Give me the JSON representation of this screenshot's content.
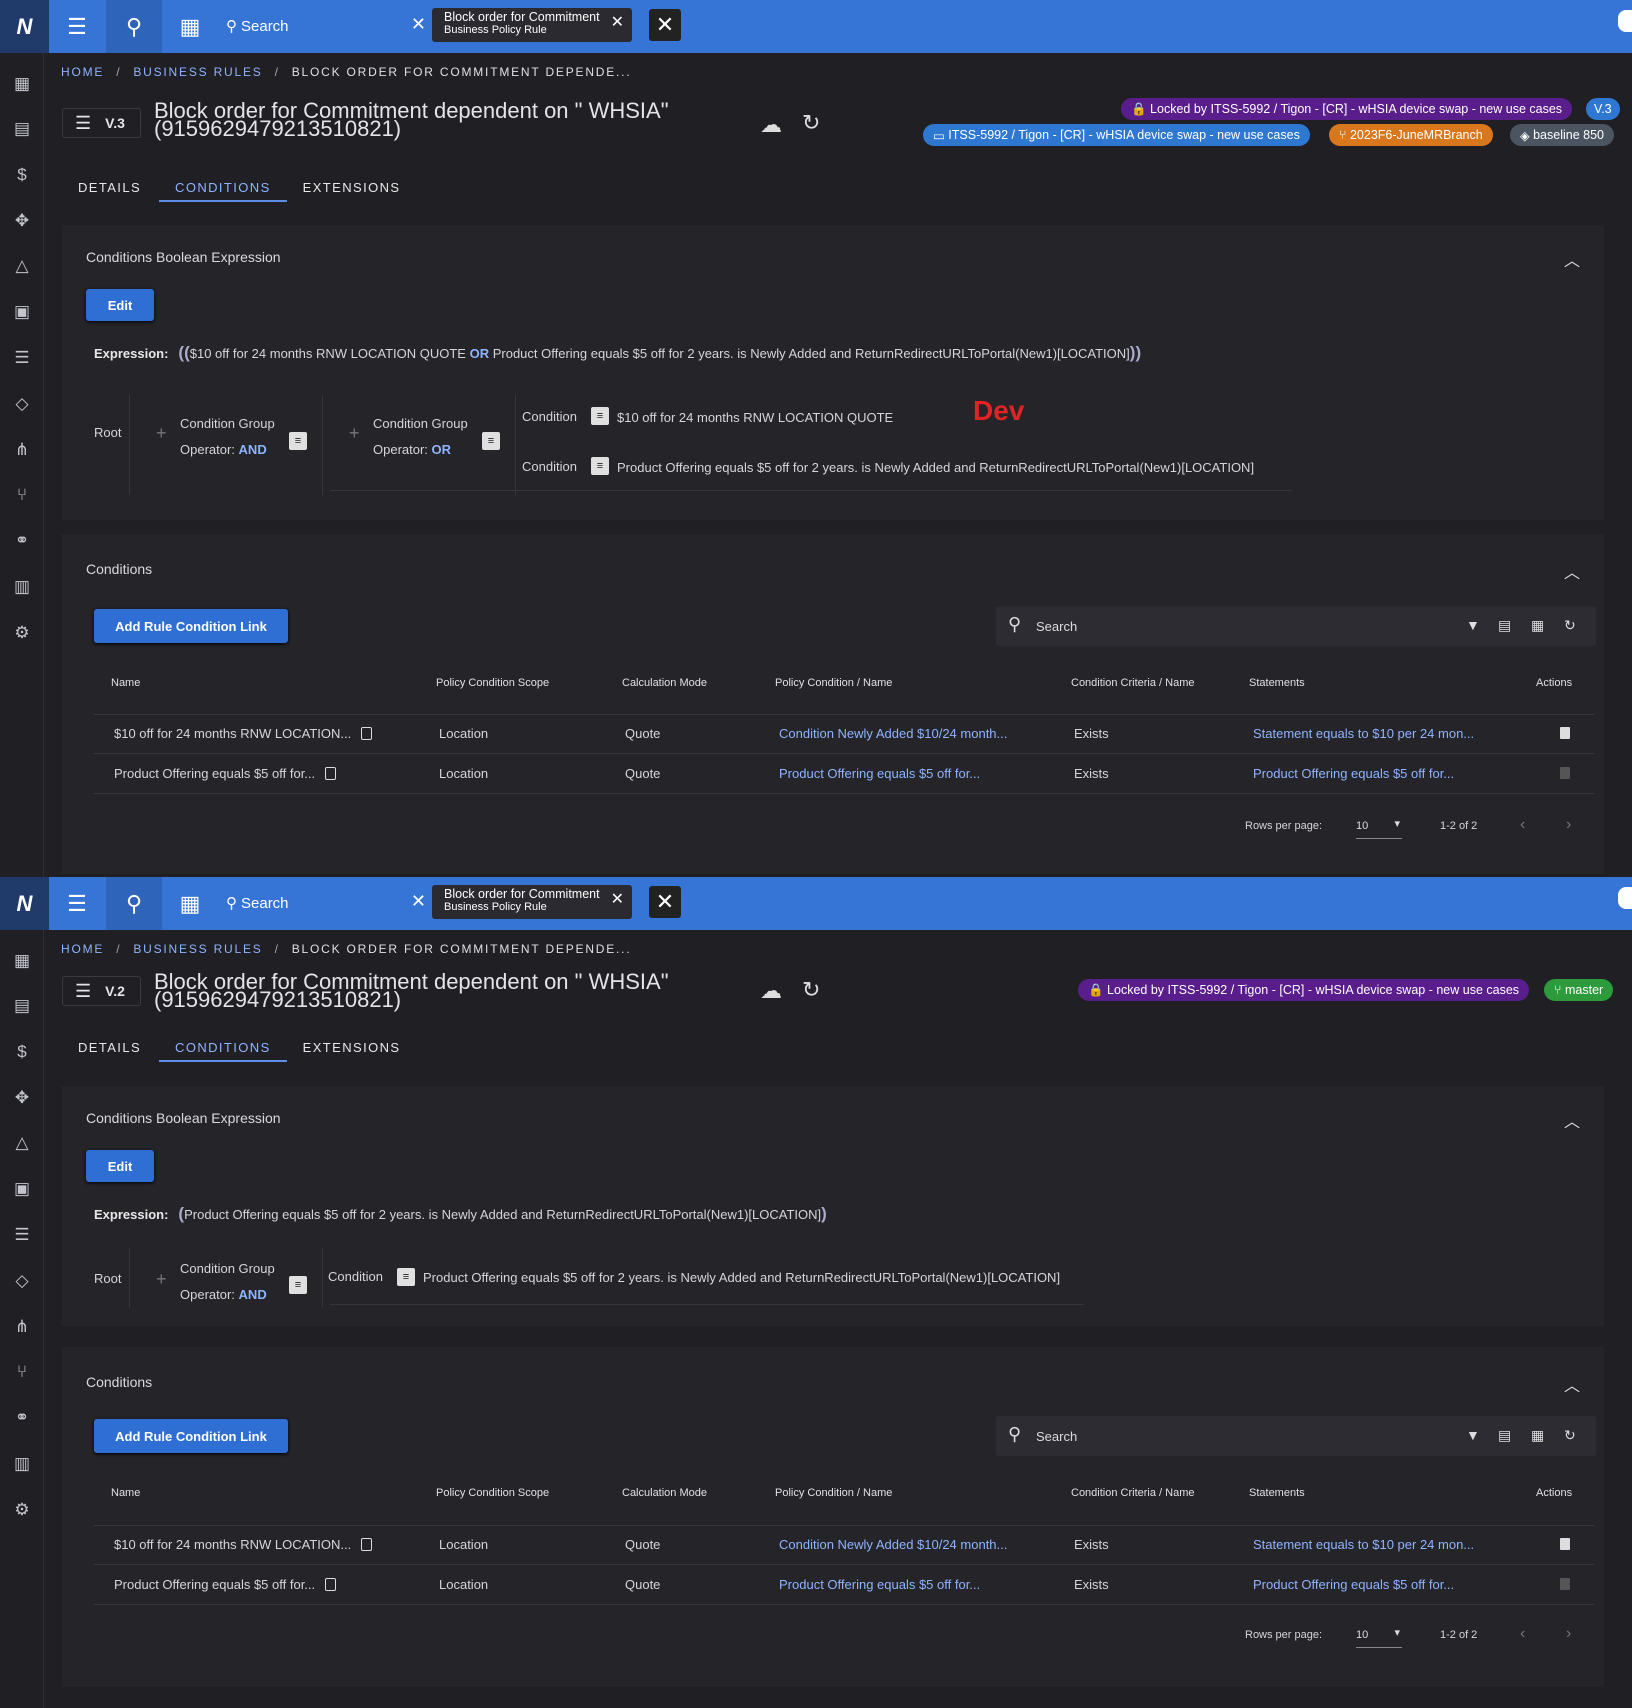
{
  "app": {
    "logo": "N",
    "search_label": "Search",
    "tab_title": "Block order for Commitment",
    "tab_subtitle": "Business Policy Rule"
  },
  "breadcrumb": {
    "home": "HOME",
    "section": "BUSINESS RULES",
    "current": "BLOCK ORDER FOR COMMITMENT DEPENDE..."
  },
  "record": {
    "title_line1": "Block order for Commitment dependent on \" WHSIA\"",
    "title_line2": "(9159629479213510821)"
  },
  "tabs": [
    "DETAILS",
    "CONDITIONS",
    "EXTENSIONS"
  ],
  "expression_panel": {
    "heading": "Conditions Boolean Expression",
    "edit_label": "Edit",
    "expression_label": "Expression:"
  },
  "conditions_panel": {
    "heading": "Conditions",
    "add_label": "Add Rule Condition Link",
    "search_placeholder": "Search",
    "columns": [
      "Name",
      "Policy Condition Scope",
      "Calculation Mode",
      "Policy Condition / Name",
      "Condition Criteria / Name",
      "Statements",
      "Actions"
    ],
    "rows": [
      {
        "name": "$10 off for 24 months RNW LOCATION...",
        "scope": "Location",
        "mode": "Quote",
        "policy": "Condition Newly Added $10/24 month...",
        "criteria": "Exists",
        "statements": "Statement equals to $10 per 24 mon..."
      },
      {
        "name": "Product Offering equals $5 off for...",
        "scope": "Location",
        "mode": "Quote",
        "policy": "Product Offering equals $5 off for...",
        "criteria": "Exists",
        "statements": "Product Offering equals $5 off for..."
      }
    ],
    "rows_per_page_label": "Rows per page:",
    "rows_per_page": "10",
    "range": "1-2 of 2"
  },
  "tree_labels": {
    "root": "Root",
    "group": "Condition Group",
    "operator": "Operator:",
    "condition": "Condition"
  },
  "top": {
    "version": "V.3",
    "lock": "Locked by ITSS-5992 / Tigon - [CR] - wHSIA device swap - new use cases",
    "version_chip": "V.3",
    "ticket": "ITSS-5992 / Tigon - [CR] - wHSIA device swap - new use cases",
    "branch": "2023F6-JuneMRBranch",
    "baseline": "baseline 850",
    "annotation": "Dev",
    "expr_part1": "$10 off for 24 months RNW LOCATION QUOTE",
    "expr_op": "OR",
    "expr_part2": "Product Offering equals $5 off for 2 years. is Newly Added and ReturnRedirectURLToPortal(New1)[LOCATION]",
    "op1": "AND",
    "op2": "OR",
    "cond1": "$10 off for 24 months RNW LOCATION QUOTE",
    "cond2": "Product Offering equals $5 off for 2 years. is Newly Added and ReturnRedirectURLToPortal(New1)[LOCATION]"
  },
  "bottom": {
    "version": "V.2",
    "lock": "Locked by ITSS-5992 / Tigon - [CR] - wHSIA device swap - new use cases",
    "branch": "master",
    "expr": "Product Offering equals $5 off for 2 years. is Newly Added and ReturnRedirectURLToPortal(New1)[LOCATION]",
    "op1": "AND",
    "cond1": "Product Offering equals $5 off for 2 years. is Newly Added and ReturnRedirectURLToPortal(New1)[LOCATION]"
  },
  "colors": {
    "topbar": "#3674d6",
    "accent": "#8fb4ff",
    "purple_chip": "#5a1e8c",
    "orange_chip": "#d9771d",
    "green_chip": "#2d9a3c",
    "dev_label": "#e02424"
  }
}
